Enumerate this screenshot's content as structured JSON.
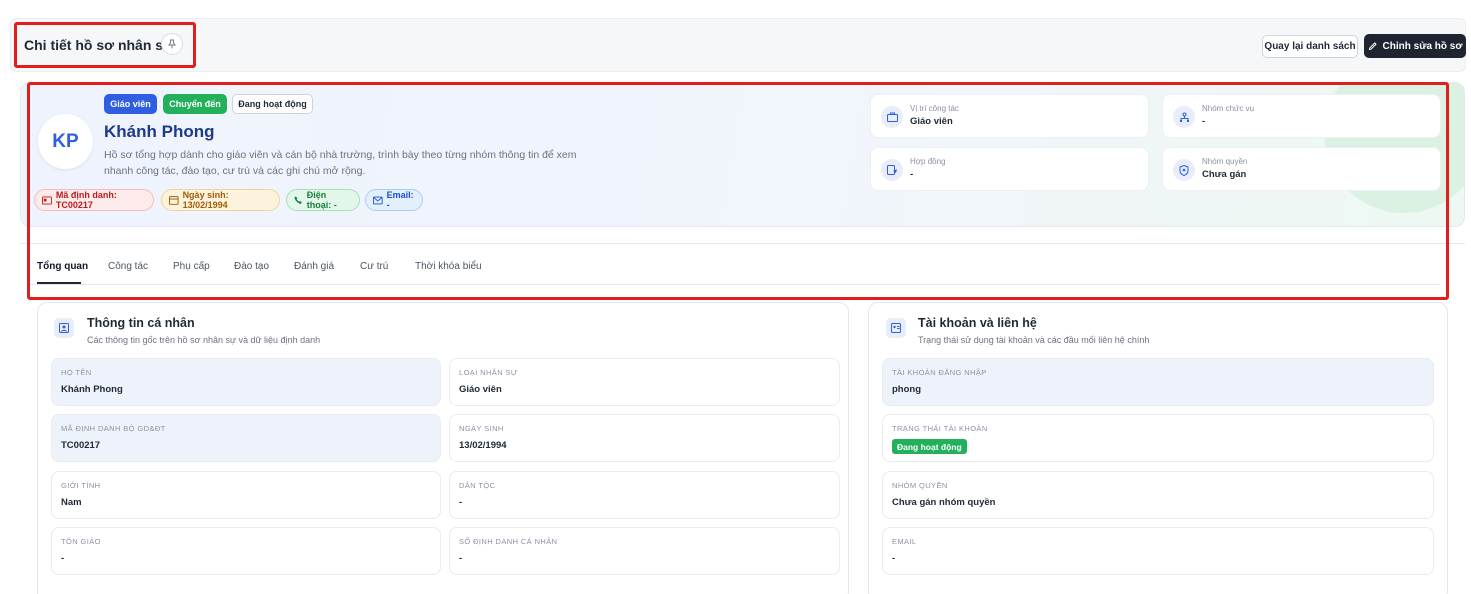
{
  "header": {
    "title": "Chi tiết hồ sơ nhân sự",
    "back_label": "Quay lại danh sách",
    "edit_label": "Chỉnh sửa hồ sơ"
  },
  "profile": {
    "initials": "KP",
    "name": "Khánh Phong",
    "badges": [
      "Giáo viên",
      "Chuyển đến",
      "Đang hoạt động"
    ],
    "description": "Hồ sơ tổng hợp dành cho giáo viên và cán bộ nhà trường, trình bày theo từng nhóm thông tin để xem nhanh công tác, đào tạo, cư trú và các ghi chú mở rộng.",
    "chips": {
      "id": "Mã định danh: TC00217",
      "dob": "Ngày sinh: 13/02/1994",
      "phone": "Điện thoại: -",
      "email": "Email: -"
    },
    "info": [
      {
        "label": "Vị trí công tác",
        "value": "Giáo viên",
        "icon": "briefcase-icon"
      },
      {
        "label": "Nhóm chức vụ",
        "value": "-",
        "icon": "org-chart-icon"
      },
      {
        "label": "Hợp đồng",
        "value": "-",
        "icon": "contract-icon"
      },
      {
        "label": "Nhóm quyền",
        "value": "Chưa gán",
        "icon": "shield-icon"
      }
    ]
  },
  "tabs": [
    "Tổng quan",
    "Công tác",
    "Phụ cấp",
    "Đào tạo",
    "Đánh giá",
    "Cư trú",
    "Thời khóa biểu"
  ],
  "personal": {
    "title": "Thông tin cá nhân",
    "subtitle": "Các thông tin gốc trên hồ sơ nhân sự và dữ liệu định danh",
    "fields": [
      {
        "label": "Họ tên",
        "value": "Khánh Phong"
      },
      {
        "label": "Loại nhân sự",
        "value": "Giáo viên"
      },
      {
        "label": "Mã định danh Bộ GD&ĐT",
        "value": "TC00217"
      },
      {
        "label": "Ngày sinh",
        "value": "13/02/1994"
      },
      {
        "label": "Giới tính",
        "value": "Nam"
      },
      {
        "label": "Dân tộc",
        "value": "-"
      },
      {
        "label": "Tôn giáo",
        "value": "-"
      },
      {
        "label": "Số định danh cá nhân",
        "value": "-"
      }
    ]
  },
  "account": {
    "title": "Tài khoản và liên hệ",
    "subtitle": "Trạng thái sử dụng tài khoản và các đầu mối liên hệ chính",
    "fields": [
      {
        "label": "Tài khoản đăng nhập",
        "value": "phong"
      },
      {
        "label": "Trạng thái tài khoản",
        "value": "Đang hoạt động"
      },
      {
        "label": "Nhóm quyền",
        "value": "Chưa gán nhóm quyền"
      },
      {
        "label": "Email",
        "value": "-"
      }
    ]
  },
  "colors": {
    "primary": "#2f5fe0",
    "success": "#22b05a",
    "dark_button": "#1f2530",
    "highlight_border": "#e11d1d"
  }
}
